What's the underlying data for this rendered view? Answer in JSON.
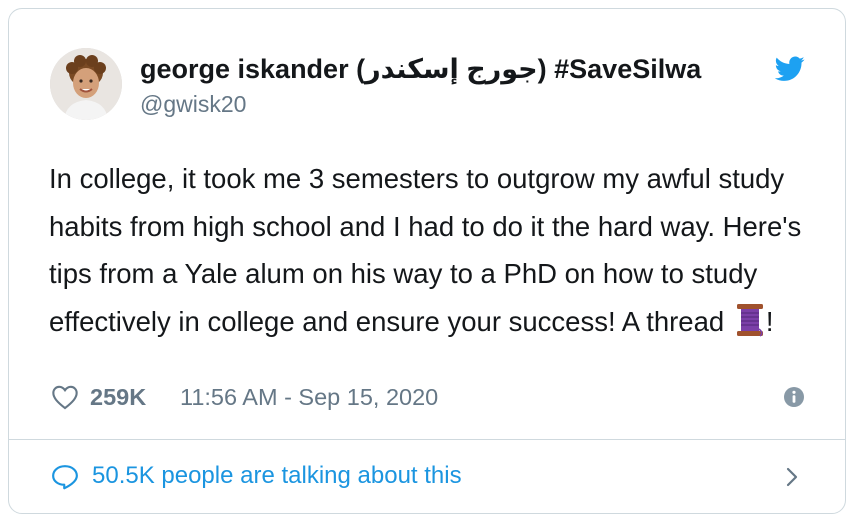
{
  "tweet": {
    "display_name": "george iskander (جورج إسكندر) #SaveSilwa",
    "handle": "@gwisk20",
    "text": "In college, it took me 3 semesters to outgrow my awful study habits from high school and I had to do it the hard way. Here's tips from a Yale alum on his way to a PhD on how to study effectively in college and ensure your success! A thread",
    "text_suffix": "!",
    "likes": "259K",
    "timestamp": "11:56 AM - Sep 15, 2020",
    "conversation": "50.5K people are talking about this"
  },
  "icons": {
    "avatar": "profile-photo",
    "logo": "twitter-bird-icon",
    "emoji": "thread-spool-emoji",
    "like": "heart-outline-icon",
    "info": "info-icon",
    "conversation": "speech-bubble-icon",
    "expand": "chevron-right-icon"
  },
  "colors": {
    "brand": "#1da1f2",
    "link": "#1b95e0",
    "muted": "#657786",
    "border": "#cfd9de",
    "text": "#14171a"
  }
}
